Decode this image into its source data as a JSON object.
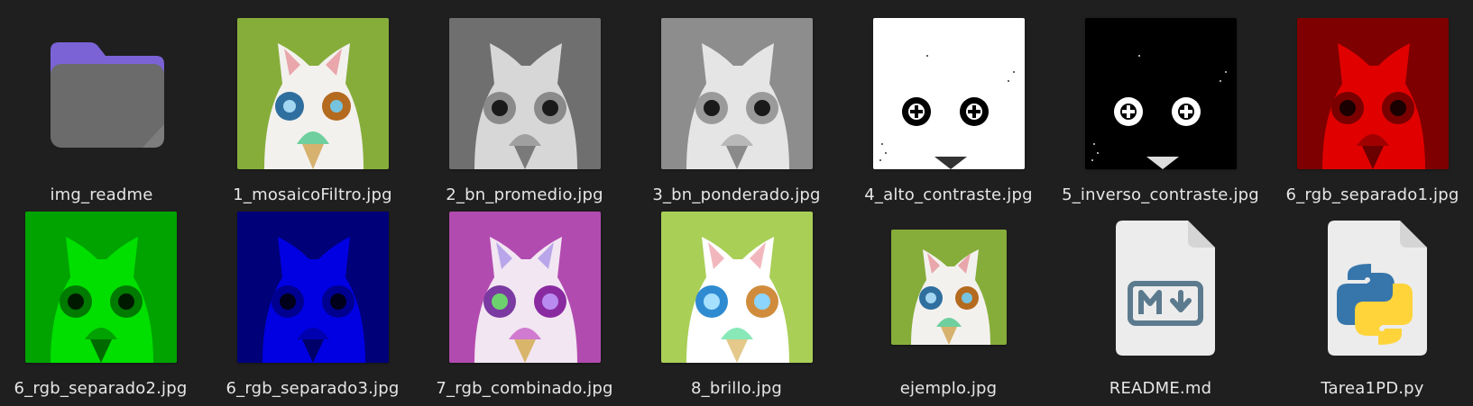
{
  "files": [
    {
      "name": "img_readme",
      "kind": "folder",
      "icon": "folder-icon"
    },
    {
      "name": "1_mosaicoFiltro.jpg",
      "kind": "image",
      "icon": "image-thumbnail-icon",
      "tint": "mosaic",
      "bg": "#86ad3a"
    },
    {
      "name": "2_bn_promedio.jpg",
      "kind": "image",
      "icon": "image-thumbnail-icon",
      "tint": "gray",
      "bg": "#6f6f6f"
    },
    {
      "name": "3_bn_ponderado.jpg",
      "kind": "image",
      "icon": "image-thumbnail-icon",
      "tint": "gray2",
      "bg": "#8d8d8d"
    },
    {
      "name": "4_alto_contraste.jpg",
      "kind": "image",
      "icon": "image-thumbnail-icon",
      "tint": "highcontrast",
      "bg": "#ffffff"
    },
    {
      "name": "5_inverso_contraste.jpg",
      "kind": "image",
      "icon": "image-thumbnail-icon",
      "tint": "inverse",
      "bg": "#000000"
    },
    {
      "name": "6_rgb_separado1.jpg",
      "kind": "image",
      "icon": "image-thumbnail-icon",
      "tint": "red",
      "bg": "#7f0000"
    },
    {
      "name": "6_rgb_separado2.jpg",
      "kind": "image",
      "icon": "image-thumbnail-icon",
      "tint": "green",
      "bg": "#00a300"
    },
    {
      "name": "6_rgb_separado3.jpg",
      "kind": "image",
      "icon": "image-thumbnail-icon",
      "tint": "blue",
      "bg": "#000078"
    },
    {
      "name": "7_rgb_combinado.jpg",
      "kind": "image",
      "icon": "image-thumbnail-icon",
      "tint": "combined",
      "bg": "#b24bb0"
    },
    {
      "name": "8_brillo.jpg",
      "kind": "image",
      "icon": "image-thumbnail-icon",
      "tint": "bright",
      "bg": "#a9cf57"
    },
    {
      "name": "ejemplo.jpg",
      "kind": "image",
      "icon": "image-thumbnail-icon",
      "tint": "example",
      "bg": "#86ad3a"
    },
    {
      "name": "README.md",
      "kind": "markdown",
      "icon": "markdown-file-icon"
    },
    {
      "name": "Tarea1PD.py",
      "kind": "python",
      "icon": "python-file-icon"
    }
  ],
  "colors": {
    "background": "#1f1f1f",
    "label": "#e6e6e6",
    "folder_purple": "#7b63d6"
  }
}
